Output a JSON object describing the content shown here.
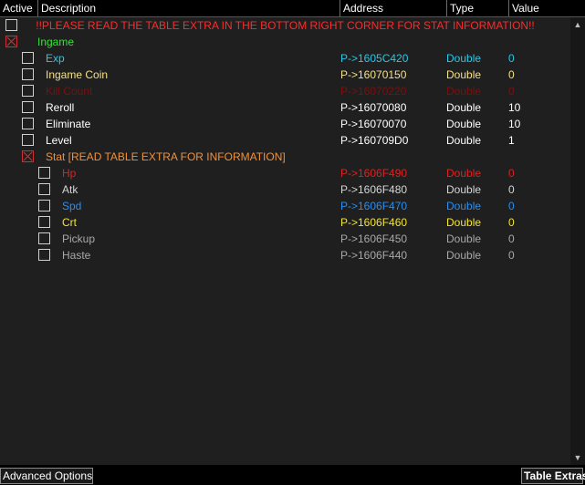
{
  "header": {
    "active": "Active",
    "description": "Description",
    "address": "Address",
    "type": "Type",
    "value": "Value"
  },
  "banner": {
    "text": "!!PLEASE READ THE TABLE EXTRA IN THE BOTTOM RIGHT CORNER FOR STAT INFORMATION!!",
    "color": "#ff2a2a"
  },
  "group_ingame": {
    "label": "Ingame",
    "color": "#2fe82f"
  },
  "ingame_rows": [
    {
      "desc": "Exp",
      "addr": "P->1605C420",
      "type": "Double",
      "value": "0",
      "color": "#27c8e8"
    },
    {
      "desc": "Ingame Coin",
      "addr": "P->16070150",
      "type": "Double",
      "value": "0",
      "color": "#f3e08a"
    },
    {
      "desc": "Kill Count",
      "addr": "P->16070220",
      "type": "Double",
      "value": "0",
      "color": "#7a1010"
    },
    {
      "desc": "Reroll",
      "addr": "P->16070080",
      "type": "Double",
      "value": "10",
      "color": "#ffffff"
    },
    {
      "desc": "Eliminate",
      "addr": "P->16070070",
      "type": "Double",
      "value": "10",
      "color": "#ffffff"
    },
    {
      "desc": "Level",
      "addr": "P->160709D0",
      "type": "Double",
      "value": "1",
      "color": "#ffffff"
    }
  ],
  "group_stat": {
    "label": "Stat [READ TABLE EXTRA FOR INFORMATION]",
    "color": "#f0913a"
  },
  "stat_rows": [
    {
      "desc": "Hp",
      "addr": "P->1606F490",
      "type": "Double",
      "value": "0",
      "color": "#e02020"
    },
    {
      "desc": "Atk",
      "addr": "P->1606F480",
      "type": "Double",
      "value": "0",
      "color": "#d6d6d6"
    },
    {
      "desc": "Spd",
      "addr": "P->1606F470",
      "type": "Double",
      "value": "0",
      "color": "#2a8ef0"
    },
    {
      "desc": "Crt",
      "addr": "P->1606F460",
      "type": "Double",
      "value": "0",
      "color": "#f2e430"
    },
    {
      "desc": "Pickup",
      "addr": "P->1606F450",
      "type": "Double",
      "value": "0",
      "color": "#a8a8a8"
    },
    {
      "desc": "Haste",
      "addr": "P->1606F440",
      "type": "Double",
      "value": "0",
      "color": "#a8a8a8"
    }
  ],
  "footer": {
    "advanced_options": "Advanced Options",
    "table_extras": "Table Extras"
  },
  "icons": {
    "scroll_up": "scroll-up-arrow-icon",
    "scroll_down": "scroll-down-arrow-icon",
    "checkbox_checked": "red-x-checkbox-icon"
  }
}
